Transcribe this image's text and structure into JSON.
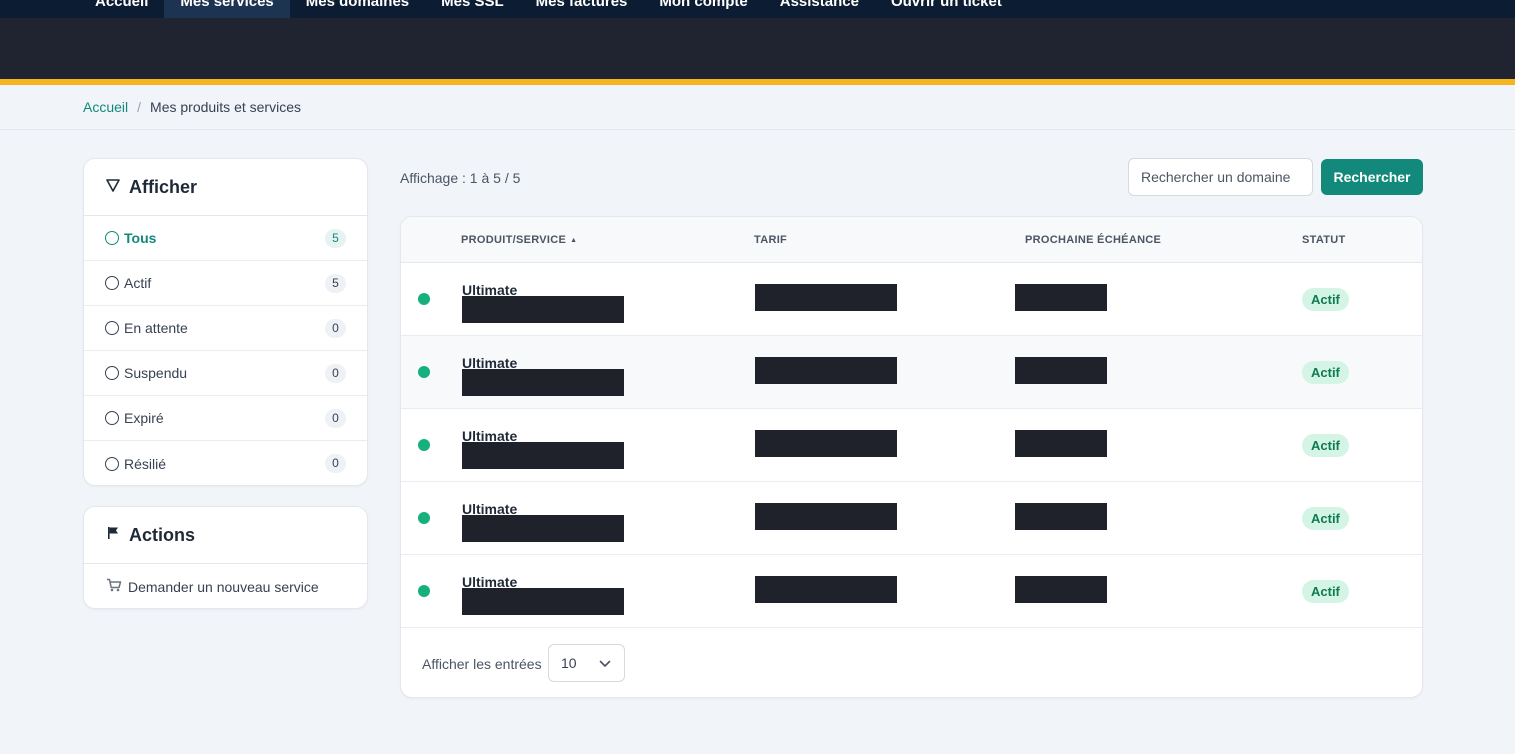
{
  "nav": {
    "items": [
      {
        "label": "Accueil",
        "active": false
      },
      {
        "label": "Mes services",
        "active": true
      },
      {
        "label": "Mes domaines",
        "active": false
      },
      {
        "label": "Mes SSL",
        "active": false
      },
      {
        "label": "Mes factures",
        "active": false
      },
      {
        "label": "Mon compte",
        "active": false
      },
      {
        "label": "Assistance",
        "active": false
      },
      {
        "label": "Ouvrir un ticket",
        "active": false
      }
    ]
  },
  "colors": {
    "accent": "#12897b",
    "nav_bg": "#0c1d33",
    "banner_bg": "#1f2430",
    "stripe": "#f4b51e",
    "status_active": "#16b07c"
  },
  "breadcrumb": {
    "home": "Accueil",
    "separator": "/",
    "current": "Mes produits et services"
  },
  "filter": {
    "title": "Afficher",
    "icon": "filter-icon",
    "items": [
      {
        "label": "Tous",
        "count": "5",
        "active": true
      },
      {
        "label": "Actif",
        "count": "5",
        "active": false
      },
      {
        "label": "En attente",
        "count": "0",
        "active": false
      },
      {
        "label": "Suspendu",
        "count": "0",
        "active": false
      },
      {
        "label": "Expiré",
        "count": "0",
        "active": false
      },
      {
        "label": "Résilié",
        "count": "0",
        "active": false
      }
    ]
  },
  "actions": {
    "title": "Actions",
    "icon": "flag-icon",
    "items": [
      {
        "label": "Demander un nouveau service",
        "icon": "cart-icon"
      }
    ]
  },
  "listing": {
    "showing": "Affichage : 1 à 5 / 5",
    "search_placeholder": "Rechercher un domaine",
    "search_button": "Rechercher"
  },
  "table": {
    "headers": {
      "product": "PRODUIT/SERVICE",
      "tarif": "TARIF",
      "due": "PROCHAINE ÉCHÉANCE",
      "status": "STATUT"
    },
    "sort_indicator": "▲",
    "rows": [
      {
        "product": "Ultimate",
        "status": "Actif"
      },
      {
        "product": "Ultimate",
        "status": "Actif"
      },
      {
        "product": "Ultimate",
        "status": "Actif"
      },
      {
        "product": "Ultimate",
        "status": "Actif"
      },
      {
        "product": "Ultimate",
        "status": "Actif"
      }
    ],
    "footer": {
      "entries_label": "Afficher les entrées",
      "entries_value": "10"
    }
  }
}
